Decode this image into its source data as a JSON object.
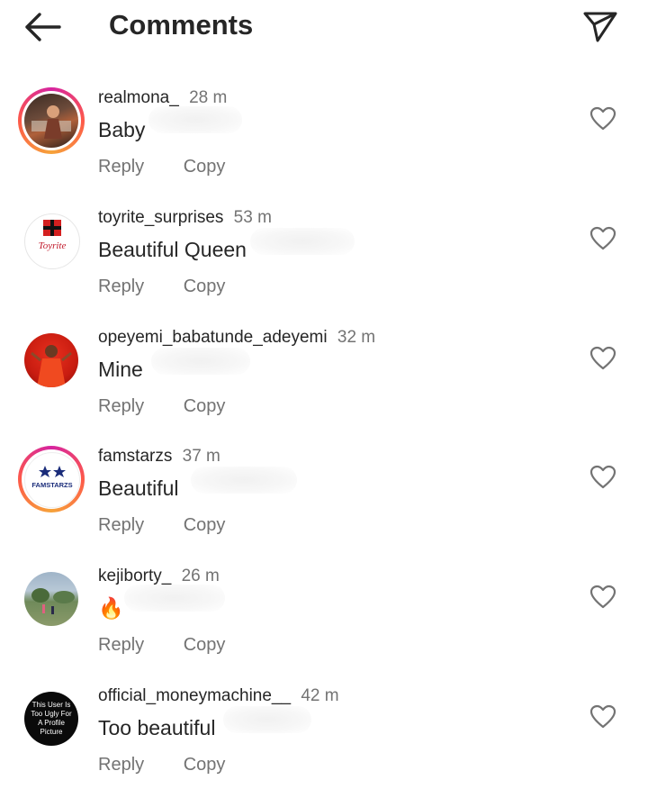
{
  "header": {
    "title": "Comments"
  },
  "icons": {
    "back": "arrow-left-icon",
    "send": "paper-plane-icon",
    "like": "heart-outline-icon"
  },
  "colors": {
    "text": "#262626",
    "secondary": "#737373",
    "story_ring_start": "#d6249f",
    "story_ring_end": "#f6a33a"
  },
  "comments": [
    {
      "username": "realmona_",
      "time": "28 m",
      "text": "Baby",
      "reply": "Reply",
      "copy": "Copy"
    },
    {
      "username": "toyrite_surprises",
      "time": "53 m",
      "text": "Beautiful Queen",
      "reply": "Reply",
      "copy": "Copy",
      "avatar_text": "Toyrite"
    },
    {
      "username": "opeyemi_babatunde_adeyemi",
      "time": "32 m",
      "text": "Mine",
      "reply": "Reply",
      "copy": "Copy"
    },
    {
      "username": "famstarzs",
      "time": "37 m",
      "text": "Beautiful",
      "reply": "Reply",
      "copy": "Copy",
      "avatar_text": "FAMSTARZS"
    },
    {
      "username": "kejiborty_",
      "time": "26 m",
      "text": "🔥",
      "reply": "Reply",
      "copy": "Copy"
    },
    {
      "username": "official_moneymachine__",
      "time": "42 m",
      "text": "Too beautiful",
      "reply": "Reply",
      "copy": "Copy",
      "avatar_text": "This User Is Too Ugly For A Profile Picture"
    }
  ]
}
